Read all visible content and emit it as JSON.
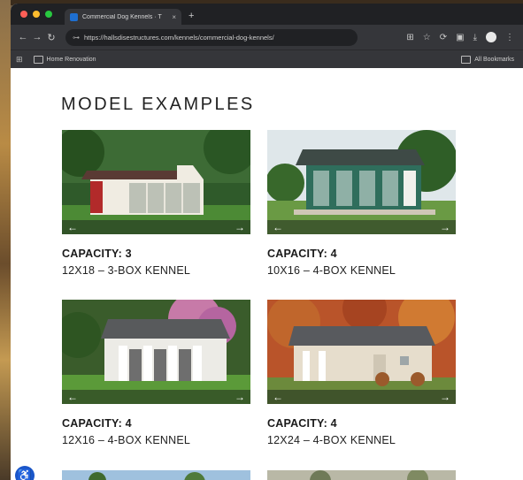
{
  "browser": {
    "tab_title": "Commercial Dog Kennels · T",
    "url": "https://hallsdisestructures.com/kennels/commercial-dog-kennels/",
    "bookmark_item": "Home Renovation",
    "all_bookmarks": "All Bookmarks",
    "colors": {
      "close": "#ff5f57",
      "minimize": "#febc2e",
      "zoom": "#28c840"
    }
  },
  "page": {
    "heading": "MODEL EXAMPLES",
    "cards": [
      {
        "capacity": "CAPACITY: 3",
        "model": "12X18 – 3-BOX KENNEL",
        "image": "kennel-photo-white-red-door"
      },
      {
        "capacity": "CAPACITY: 4",
        "model": "10X16 – 4-BOX KENNEL",
        "image": "kennel-photo-green"
      },
      {
        "capacity": "CAPACITY: 4",
        "model": "12X16 – 4-BOX KENNEL",
        "image": "kennel-photo-white-porch"
      },
      {
        "capacity": "CAPACITY: 4",
        "model": "12X24 – 4-BOX KENNEL",
        "image": "kennel-photo-tan-autumn"
      }
    ],
    "arrows": {
      "prev": "←",
      "next": "→"
    }
  },
  "icons": {
    "back": "←",
    "forward": "→",
    "reload": "↻",
    "tune": "⊶",
    "accessibility": "♿"
  }
}
